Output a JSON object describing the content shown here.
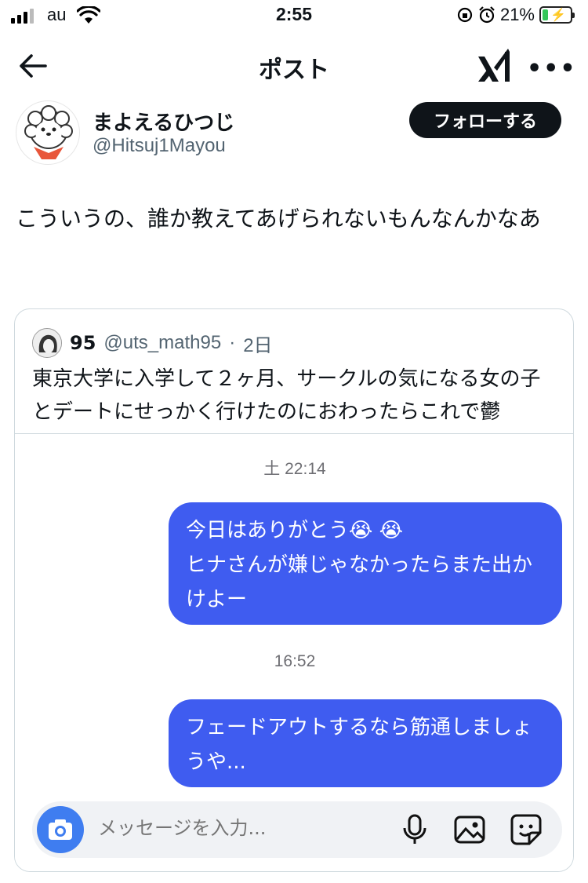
{
  "status_bar": {
    "carrier": "au",
    "time": "2:55",
    "battery_percent": "21%",
    "battery_level": 0.21
  },
  "nav": {
    "title": "ポスト",
    "back_icon": "arrow-left-icon",
    "grok_icon": "grok-icon",
    "more_icon": "more-horizontal-icon"
  },
  "author": {
    "name": "まよえるひつじ",
    "handle": "@Hitsuj1Mayou",
    "follow_label": "フォローする"
  },
  "post": {
    "text": "こういうの、誰か教えてあげられないもんなんかなあ"
  },
  "quote": {
    "name": "95",
    "handle": "@uts_math95",
    "separator": "·",
    "age": "2日",
    "text": "東京大学に入学して２ヶ月、サークルの気になる女の子とデートにせっかく行けたのにおわったらこれで鬱"
  },
  "chat": {
    "timestamp1": "土 22:14",
    "message1": "今日はありがとう😭 😭\nヒナさんが嫌じゃなかったらまた出かけよー",
    "timestamp2": "16:52",
    "message2": "フェードアウトするなら筋通しましょうや...",
    "input_placeholder": "メッセージを入力...",
    "bubble_color": "#3f5cf0",
    "icons": [
      "camera-icon",
      "microphone-icon",
      "image-icon",
      "sticker-icon"
    ]
  }
}
